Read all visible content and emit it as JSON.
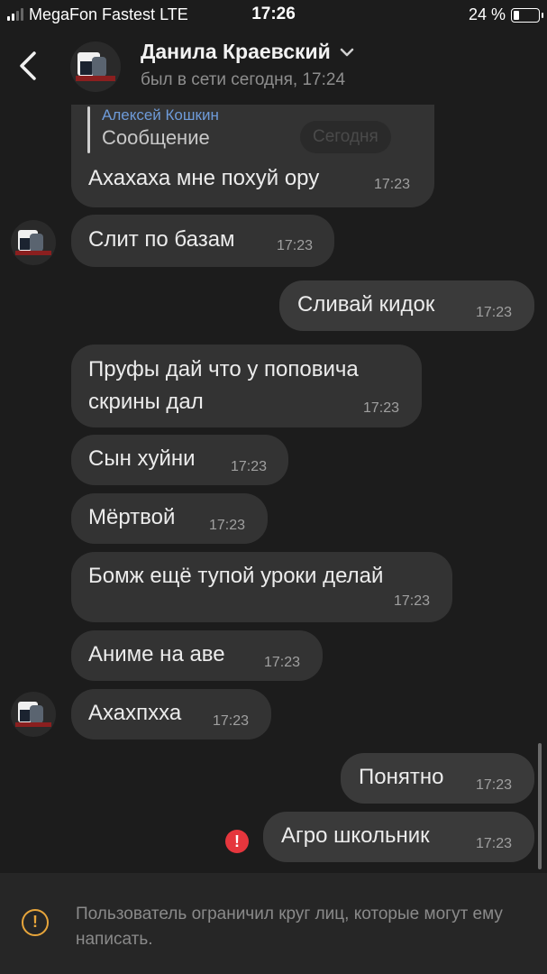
{
  "status_bar": {
    "carrier": "MegaFon Fastest  LTE",
    "time": "17:26",
    "battery": "24 %",
    "battery_level": 0.24
  },
  "header": {
    "name": "Данила Краевский",
    "last_seen": "был в сети сегодня, 17:24"
  },
  "date_pill": "Сегодня",
  "messages": [
    {
      "reply_author": "Алексей Кошкин",
      "reply_text": "Сообщение",
      "text": "Ахахаха мне похуй ору",
      "time": "17:23",
      "direction": "in"
    },
    {
      "text": "Слит по базам",
      "time": "17:23",
      "direction": "in"
    },
    {
      "text": "Сливай кидок",
      "time": "17:23",
      "direction": "out"
    },
    {
      "text_line1": "Пруфы дай что у поповича",
      "text_line2": "скрины дал",
      "time": "17:23",
      "direction": "in"
    },
    {
      "text": "Сын хуйни",
      "time": "17:23",
      "direction": "in"
    },
    {
      "text": "Мёртвой",
      "time": "17:23",
      "direction": "in"
    },
    {
      "text": "Бомж ещё тупой уроки делай",
      "time": "17:23",
      "direction": "in"
    },
    {
      "text": "Аниме на аве",
      "time": "17:23",
      "direction": "in"
    },
    {
      "text": "Ахахпхха",
      "time": "17:23",
      "direction": "in"
    },
    {
      "text": "Понятно",
      "time": "17:23",
      "direction": "out"
    },
    {
      "text": "Агро школьник",
      "time": "17:23",
      "direction": "out",
      "failed": true
    }
  ],
  "footer": {
    "notice": "Пользователь ограничил круг лиц, которые могут ему написать."
  },
  "colors": {
    "background": "#1c1c1c",
    "bubble": "#333333",
    "accent_link": "#6e9bd9",
    "error": "#e5363d",
    "warning": "#e7a53b"
  }
}
